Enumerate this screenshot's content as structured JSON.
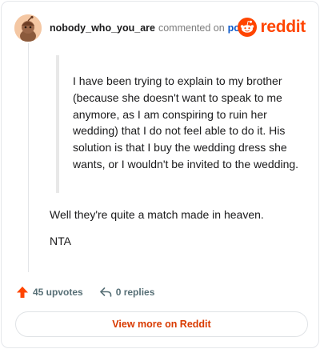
{
  "header": {
    "username": "nobody_who_you_are",
    "commented_text": "commented on",
    "post_link": "post",
    "brand": "reddit"
  },
  "quote": {
    "text": "I have been trying to explain to my brother (because she doesn't want to speak to me anymore, as I am conspiring to ruin her wedding) that I do not feel able to do it. His solution is that I buy the wedding dress she wants, or I wouldn't be invited to the wedding."
  },
  "body": {
    "paragraphs": [
      "Well they're quite a match made in heaven.",
      "NTA"
    ]
  },
  "actions": {
    "upvotes": "45 upvotes",
    "replies": "0 replies"
  },
  "footer": {
    "view_more": "View more on Reddit"
  },
  "colors": {
    "brand": "#ff4500",
    "link": "#0a58ca",
    "view_more": "#d93a00",
    "upvote": "#ff4500"
  },
  "icons": {
    "avatar": "snoo-avatar-icon",
    "brand": "reddit-logo-icon",
    "upvote": "upvote-arrow-icon",
    "reply": "reply-icon"
  }
}
